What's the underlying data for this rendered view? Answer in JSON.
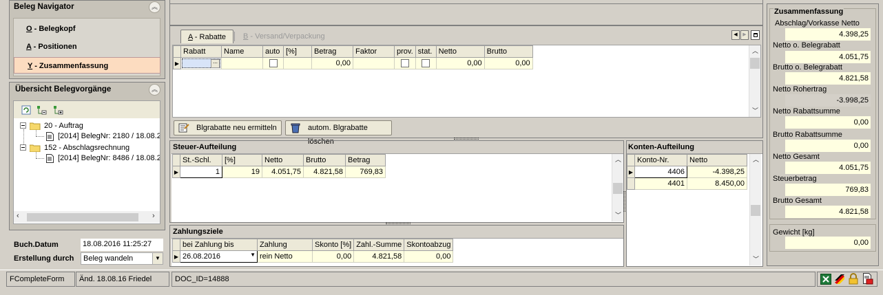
{
  "left": {
    "nav_title": "Beleg Navigator",
    "nav_items": [
      {
        "key": "O",
        "label": "O - Belegkopf"
      },
      {
        "key": "A",
        "label": "A - Positionen"
      },
      {
        "key": "Y",
        "label": "Y - Zusammenfassung"
      }
    ],
    "overview_title": "Übersicht Belegvorgänge",
    "tree": [
      {
        "label": "20 - Auftrag",
        "child": "[2014] BelegNr: 2180 / 18.08.2"
      },
      {
        "label": "152 - Abschlagsrechnung",
        "child": "[2014] BelegNr: 8486 / 18.08.2"
      }
    ],
    "buch_datum_label": "Buch.Datum",
    "buch_datum_value": "18.08.2016 11:25:27",
    "erstellung_label": "Erstellung durch",
    "erstellung_value": "Beleg wandeln"
  },
  "tabs": [
    {
      "label": "A - Rabatte",
      "active": true
    },
    {
      "label": "B - Versand/Verpackung",
      "active": false
    }
  ],
  "rabatte": {
    "headers": [
      "Rabatt",
      "Name",
      "auto",
      "[%]",
      "Betrag",
      "Faktor",
      "prov.",
      "stat.",
      "Netto",
      "Brutto"
    ],
    "row": {
      "betrag": "0,00",
      "netto": "0,00",
      "brutto": "0,00"
    },
    "btn_recalc": "Blgrabatte neu ermitteln",
    "btn_delete": "autom. Blgrabatte löschen"
  },
  "steuer": {
    "title": "Steuer-Aufteilung",
    "headers": [
      "St.-Schl.",
      "[%]",
      "Netto",
      "Brutto",
      "Betrag"
    ],
    "row": [
      "1",
      "19",
      "4.051,75",
      "4.821,58",
      "769,83"
    ]
  },
  "konten": {
    "title": "Konten-Aufteilung",
    "headers": [
      "Konto-Nr.",
      "Netto"
    ],
    "rows": [
      [
        "4406",
        "-4.398,25"
      ],
      [
        "4401",
        "8.450,00"
      ]
    ]
  },
  "zahlung": {
    "title": "Zahlungsziele",
    "headers": [
      "bei Zahlung bis",
      "Zahlung",
      "Skonto [%]",
      "Zahl.-Summe",
      "Skontoabzug"
    ],
    "row": [
      "26.08.2016",
      "rein Netto",
      "0,00",
      "4.821,58",
      "0,00"
    ]
  },
  "summary": {
    "title": "Zusammenfassung",
    "items": [
      {
        "label": "Abschlag/Vorkasse Netto",
        "value": "4.398,25"
      },
      {
        "label": "Netto o. Belegrabatt",
        "value": "4.051,75"
      },
      {
        "label": "Brutto o. Belegrabatt",
        "value": "4.821,58"
      },
      {
        "label": "Netto Rohertrag",
        "value": "-3.998,25"
      },
      {
        "label": "Netto Rabattsumme",
        "value": "0,00"
      },
      {
        "label": "Brutto Rabattsumme",
        "value": "0,00"
      },
      {
        "label": "Netto Gesamt",
        "value": "4.051,75"
      },
      {
        "label": "Steuerbetrag",
        "value": "769,83"
      },
      {
        "label": "Brutto Gesamt",
        "value": "4.821,58"
      },
      {
        "label": "Gewicht [kg]",
        "value": "0,00"
      }
    ]
  },
  "status": {
    "form": "FCompleteForm",
    "changed": "Änd. 18.08.16 Friedel",
    "doc": "DOC_ID=14888"
  }
}
